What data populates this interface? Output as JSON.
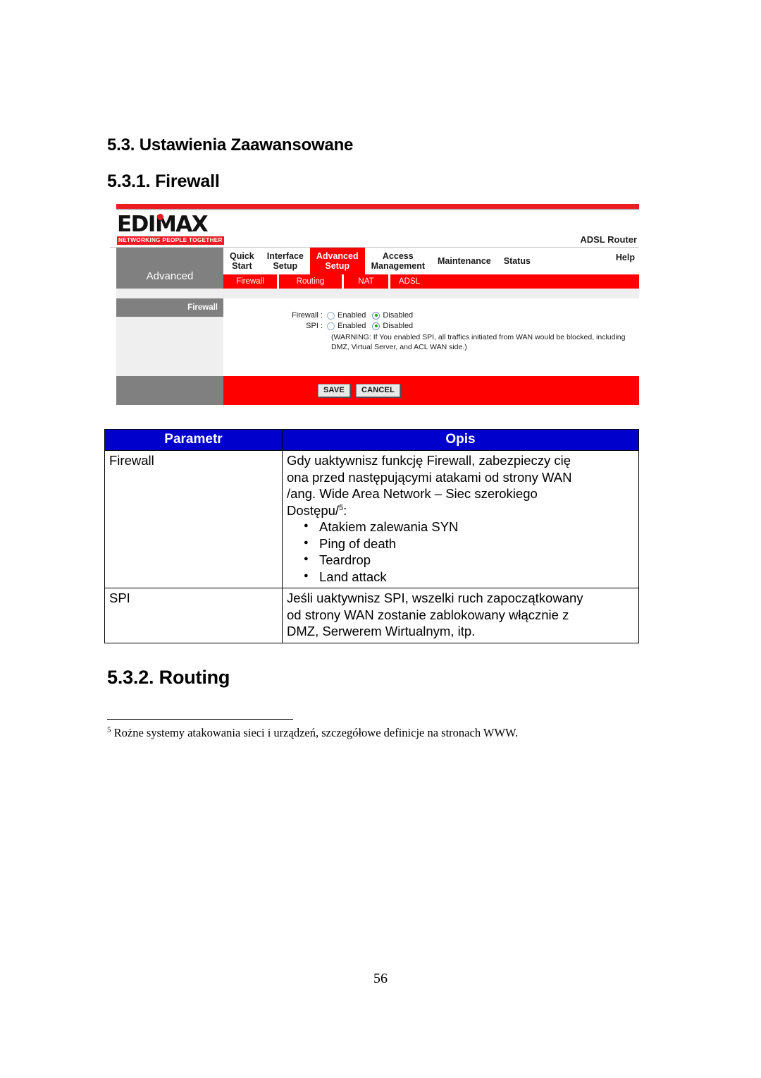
{
  "document": {
    "heading_section": "5.3. Ustawienia Zaawansowane",
    "heading_sub": "5.3.1. Firewall",
    "heading_next": "5.3.2. Routing",
    "page_number": "56",
    "footnote_marker": "5",
    "footnote_text": " Rożne systemy atakowania sieci i urządzeń, szczegółowe definicje na stronach WWW."
  },
  "router_ui": {
    "brand": {
      "logo_text": "EDIMAX",
      "tagline": "NETWORKING PEOPLE TOGETHER",
      "model_label": "ADSL Router"
    },
    "sidebar_title": "Advanced",
    "main_nav": [
      {
        "line1": "Quick",
        "line2": "Start",
        "active": false
      },
      {
        "line1": "Interface",
        "line2": "Setup",
        "active": false
      },
      {
        "line1": "Advanced",
        "line2": "Setup",
        "active": true
      },
      {
        "line1": "Access",
        "line2": "Management",
        "active": false
      },
      {
        "line1": "Maintenance",
        "line2": "",
        "active": false
      },
      {
        "line1": "Status",
        "line2": "",
        "active": false
      },
      {
        "line1": "Help",
        "line2": "",
        "active": false
      }
    ],
    "sub_nav": [
      {
        "label": "Firewall"
      },
      {
        "label": "Routing"
      },
      {
        "label": "NAT"
      },
      {
        "label": "ADSL"
      }
    ],
    "panel": {
      "section_title": "Firewall",
      "fields": [
        {
          "label": "Firewall :",
          "options": [
            {
              "label": "Enabled",
              "checked": false
            },
            {
              "label": "Disabled",
              "checked": true
            }
          ]
        },
        {
          "label": "SPI :",
          "options": [
            {
              "label": "Enabled",
              "checked": false
            },
            {
              "label": "Disabled",
              "checked": true
            }
          ]
        }
      ],
      "warning": "(WARNING: If You enabled SPI, all traffics initiated from WAN would be blocked, including DMZ, Virtual Server, and ACL WAN side.)",
      "buttons": {
        "save": "SAVE",
        "cancel": "CANCEL"
      }
    },
    "colors": {
      "accent_red": "#FF0000",
      "brand_red": "#ED1C24",
      "gray": "#808080",
      "light_gray": "#EFEFEF",
      "radio_green": "#17A81A"
    }
  },
  "param_table": {
    "headers": [
      "Parametr",
      "Opis"
    ],
    "rows": [
      {
        "parameter": "Firewall",
        "description_lines": [
          "Gdy uaktywnisz funkcję Firewall, zabezpieczy cię",
          "ona przed następującymi atakami od strony WAN",
          "/ang. Wide Area Network – Siec szerokiego",
          "Dostępu/"
        ],
        "description_sup": "5",
        "description_tail": ":",
        "bullets": [
          "Atakiem zalewania SYN",
          "Ping of death",
          "Teardrop",
          "Land attack"
        ]
      },
      {
        "parameter": "SPI",
        "description_lines": [
          "Jeśli uaktywnisz SPI, wszelki ruch zapoczątkowany",
          "od strony WAN zostanie zablokowany włącznie z",
          "DMZ, Serwerem Wirtualnym, itp."
        ],
        "description_sup": "",
        "description_tail": "",
        "bullets": []
      }
    ],
    "header_color": "#0000CD"
  }
}
